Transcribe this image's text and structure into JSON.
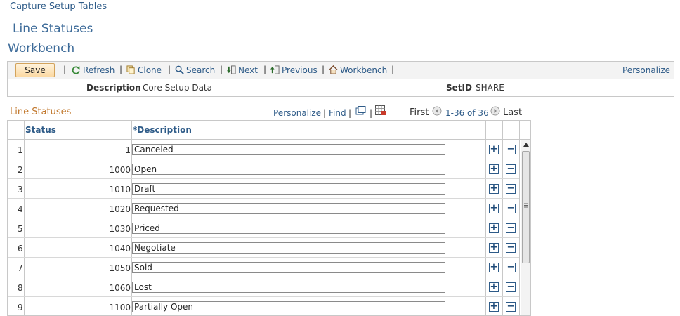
{
  "breadcrumb": "Capture Setup Tables",
  "page_title": "Line Statuses",
  "section_title": "Workbench",
  "toolbar": {
    "save": "Save",
    "refresh": "Refresh",
    "clone": "Clone",
    "search": "Search",
    "next": "Next",
    "previous": "Previous",
    "workbench": "Workbench",
    "personalize": "Personalize"
  },
  "info": {
    "description_label": "Description",
    "description_value": "Core Setup Data",
    "setid_label": "SetID",
    "setid_value": "SHARE"
  },
  "grid": {
    "title": "Line Statuses",
    "personalize": "Personalize",
    "find": "Find",
    "first": "First",
    "range": "1-36 of 36",
    "last": "Last",
    "col_status": "Status",
    "col_description": "*Description",
    "rows": [
      {
        "num": "1",
        "status": "1",
        "description": "Canceled"
      },
      {
        "num": "2",
        "status": "1000",
        "description": "Open"
      },
      {
        "num": "3",
        "status": "1010",
        "description": "Draft"
      },
      {
        "num": "4",
        "status": "1020",
        "description": "Requested"
      },
      {
        "num": "5",
        "status": "1030",
        "description": "Priced"
      },
      {
        "num": "6",
        "status": "1040",
        "description": "Negotiate"
      },
      {
        "num": "7",
        "status": "1050",
        "description": "Sold"
      },
      {
        "num": "8",
        "status": "1060",
        "description": "Lost"
      },
      {
        "num": "9",
        "status": "1100",
        "description": "Partially Open"
      }
    ]
  },
  "colors": {
    "link": "#2e5b88",
    "grid_title": "#c0762a",
    "save_button": "#fbd9a3"
  }
}
